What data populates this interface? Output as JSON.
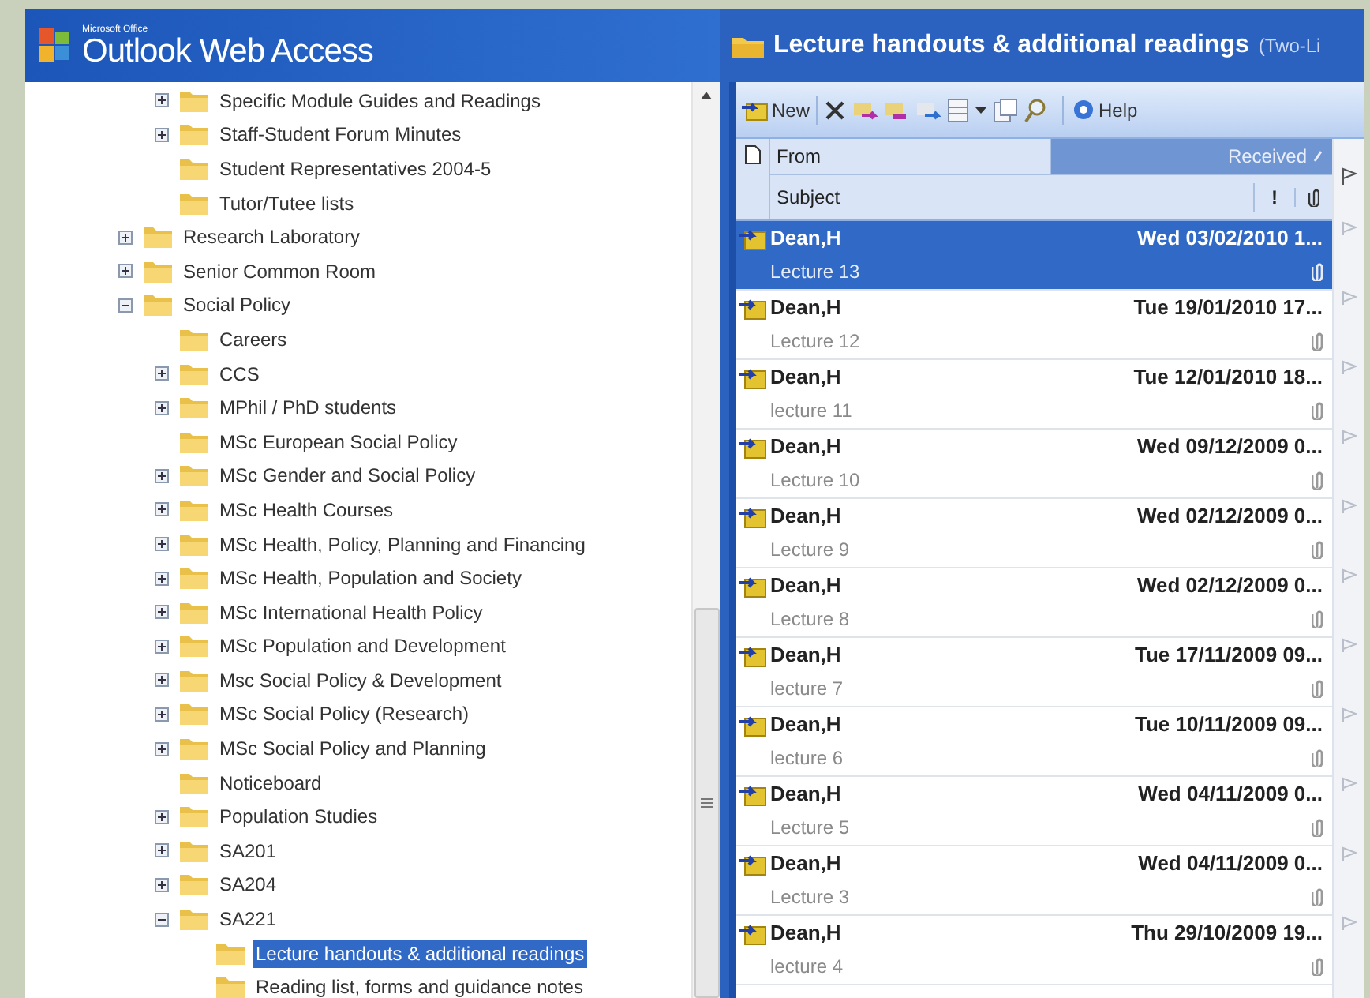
{
  "app": {
    "brand_small": "Microsoft Office",
    "brand": "Outlook Web Access"
  },
  "folder_tree": {
    "continued_items": [
      {
        "label": "Specific Module Guides and Readings",
        "expandable": true,
        "expanded": false,
        "selected": false
      },
      {
        "label": "Staff-Student Forum Minutes",
        "expandable": true,
        "expanded": false,
        "selected": false
      },
      {
        "label": "Student Representatives 2004-5",
        "expandable": false,
        "selected": false
      },
      {
        "label": "Tutor/Tutee lists",
        "expandable": false,
        "selected": false
      }
    ],
    "items": [
      {
        "label": "Research Laboratory",
        "expandable": true,
        "expanded": false,
        "selected": false
      },
      {
        "label": "Senior Common Room",
        "expandable": true,
        "expanded": false,
        "selected": false
      },
      {
        "label": "Social Policy",
        "expandable": true,
        "expanded": true,
        "selected": false,
        "children": [
          {
            "label": "Careers",
            "expandable": false,
            "selected": false
          },
          {
            "label": "CCS",
            "expandable": true,
            "expanded": false,
            "selected": false
          },
          {
            "label": "MPhil / PhD students",
            "expandable": true,
            "expanded": false,
            "selected": false
          },
          {
            "label": "MSc European Social Policy",
            "expandable": false,
            "selected": false
          },
          {
            "label": "MSc Gender and Social Policy",
            "expandable": true,
            "expanded": false,
            "selected": false
          },
          {
            "label": "MSc Health Courses",
            "expandable": true,
            "expanded": false,
            "selected": false
          },
          {
            "label": "MSc Health, Policy, Planning and Financing",
            "expandable": true,
            "expanded": false,
            "selected": false
          },
          {
            "label": "MSc Health, Population and Society",
            "expandable": true,
            "expanded": false,
            "selected": false
          },
          {
            "label": "MSc International Health Policy",
            "expandable": true,
            "expanded": false,
            "selected": false
          },
          {
            "label": "MSc Population and Development",
            "expandable": true,
            "expanded": false,
            "selected": false
          },
          {
            "label": "Msc Social Policy & Development",
            "expandable": true,
            "expanded": false,
            "selected": false
          },
          {
            "label": "MSc Social Policy (Research)",
            "expandable": true,
            "expanded": false,
            "selected": false
          },
          {
            "label": "MSc Social Policy and Planning",
            "expandable": true,
            "expanded": false,
            "selected": false
          },
          {
            "label": "Noticeboard",
            "expandable": false,
            "selected": false
          },
          {
            "label": "Population Studies",
            "expandable": true,
            "expanded": false,
            "selected": false
          },
          {
            "label": "SA201",
            "expandable": true,
            "expanded": false,
            "selected": false
          },
          {
            "label": "SA204",
            "expandable": true,
            "expanded": false,
            "selected": false
          },
          {
            "label": "SA221",
            "expandable": true,
            "expanded": true,
            "selected": false,
            "children": [
              {
                "label": "Lecture handouts & additional readings",
                "expandable": false,
                "selected": true
              },
              {
                "label": "Reading list, forms and guidance notes",
                "expandable": false,
                "selected": false
              }
            ]
          }
        ]
      }
    ]
  },
  "folder_view": {
    "title": "Lecture handouts & additional readings",
    "view_note": "(Two-Li",
    "toolbar": {
      "new_label": "New",
      "help_label": "Help"
    },
    "header_row1": [
      {
        "label": "From",
        "sorted": false
      },
      {
        "label": "Received",
        "sorted": true
      }
    ],
    "header_row2": {
      "subject": "Subject",
      "importance": "!"
    },
    "messages": [
      {
        "from": "Dean,H",
        "received": "Wed 03/02/2010 1...",
        "subject": "Lecture 13",
        "selected": true,
        "attachment": true
      },
      {
        "from": "Dean,H",
        "received": "Tue 19/01/2010 17...",
        "subject": "Lecture 12",
        "selected": false,
        "attachment": true
      },
      {
        "from": "Dean,H",
        "received": "Tue 12/01/2010 18...",
        "subject": "lecture 11",
        "selected": false,
        "attachment": true
      },
      {
        "from": "Dean,H",
        "received": "Wed 09/12/2009 0...",
        "subject": "Lecture 10",
        "selected": false,
        "attachment": true
      },
      {
        "from": "Dean,H",
        "received": "Wed 02/12/2009 0...",
        "subject": "Lecture 9",
        "selected": false,
        "attachment": true
      },
      {
        "from": "Dean,H",
        "received": "Wed 02/12/2009 0...",
        "subject": "Lecture 8",
        "selected": false,
        "attachment": true
      },
      {
        "from": "Dean,H",
        "received": "Tue 17/11/2009 09...",
        "subject": "lecture 7",
        "selected": false,
        "attachment": true
      },
      {
        "from": "Dean,H",
        "received": "Tue 10/11/2009 09...",
        "subject": "lecture 6",
        "selected": false,
        "attachment": true
      },
      {
        "from": "Dean,H",
        "received": "Wed 04/11/2009 0...",
        "subject": "Lecture 5",
        "selected": false,
        "attachment": true
      },
      {
        "from": "Dean,H",
        "received": "Wed 04/11/2009 0...",
        "subject": "Lecture 3",
        "selected": false,
        "attachment": true
      },
      {
        "from": "Dean,H",
        "received": "Thu 29/10/2009 19...",
        "subject": "lecture 4",
        "selected": false,
        "attachment": true
      }
    ]
  }
}
